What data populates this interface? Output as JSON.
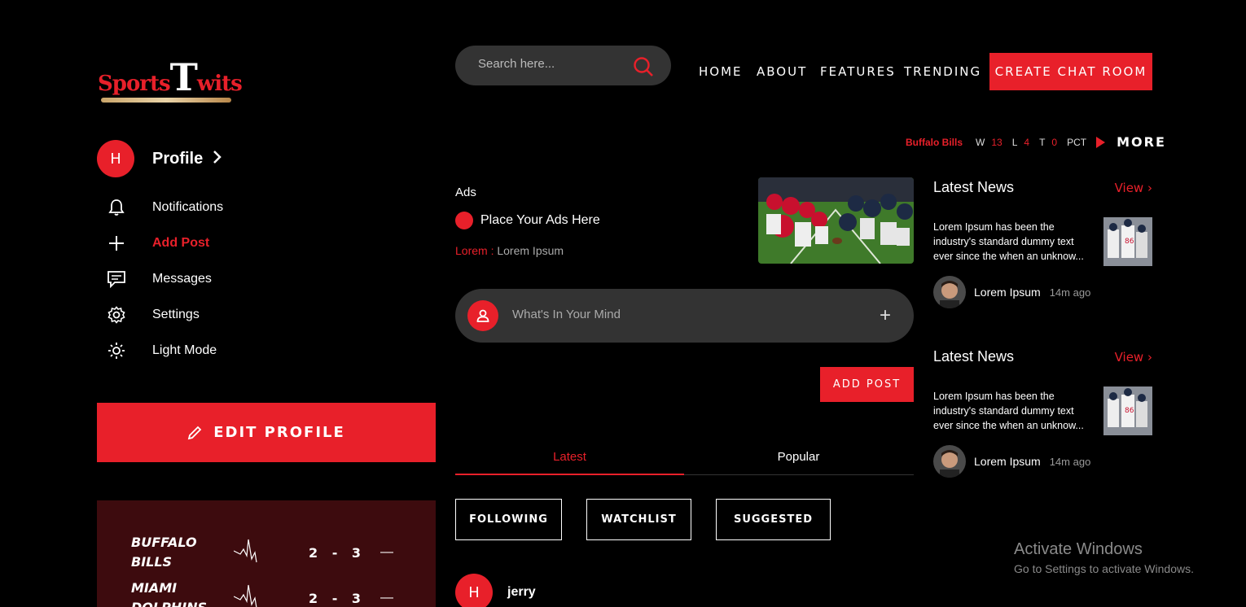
{
  "logo": {
    "part1": "Sports",
    "part2": "T",
    "part3": "wits"
  },
  "profile": {
    "initial": "H",
    "label": "Profile"
  },
  "nav": [
    {
      "label": "Notifications",
      "icon": "bell-icon"
    },
    {
      "label": "Add Post",
      "icon": "plus-icon"
    },
    {
      "label": "Messages",
      "icon": "message-icon"
    },
    {
      "label": "Settings",
      "icon": "gear-icon"
    },
    {
      "label": "Light Mode",
      "icon": "sun-icon"
    }
  ],
  "edit_profile": "EDIT PROFILE",
  "scores": [
    {
      "team": "BUFFALO BILLS",
      "score": "2 - 3",
      "dash": "—"
    },
    {
      "team": "MIAMI DOLPHINS",
      "score": "2 - 3",
      "dash": "—"
    }
  ],
  "search": {
    "placeholder": "Search here..."
  },
  "top_nav": [
    "HOME",
    "ABOUT",
    "FEATURES",
    "TRENDING"
  ],
  "create_chat": "CREATE CHAT ROOM",
  "standings": {
    "team": "Buffalo Bills",
    "w_label": "W",
    "w": "13",
    "l_label": "L",
    "l": "4",
    "t_label": "T",
    "t": "0",
    "pct_label": "PCT",
    "more": "MORE"
  },
  "ads": {
    "title": "Ads",
    "place": "Place Your Ads Here",
    "lorem_red": "Lorem :",
    "lorem": "Lorem Ipsum"
  },
  "composer": {
    "placeholder": "What's In Your Mind",
    "plus": "+"
  },
  "add_post": "ADD POST",
  "tabs": [
    "Latest",
    "Popular"
  ],
  "filters": [
    "FOLLOWING",
    "WATCHLIST",
    "SUGGESTED"
  ],
  "post": {
    "initial": "H",
    "user": "jerry"
  },
  "news": [
    {
      "title": "Latest News",
      "view": "View",
      "text": "Lorem Ipsum has been the industry's standard dummy text ever since the when an unknow...",
      "author": "Lorem Ipsum",
      "time": "14m ago"
    },
    {
      "title": "Latest News",
      "view": "View",
      "text": "Lorem Ipsum has been the industry's standard dummy text ever since the when an unknow...",
      "author": "Lorem Ipsum",
      "time": "14m ago"
    }
  ],
  "activate": {
    "title": "Activate Windows",
    "sub": "Go to Settings to activate Windows."
  },
  "colors": {
    "accent": "#e8202a",
    "background": "#000000",
    "panel": "#333333",
    "score_panel": "#3d0b0e"
  }
}
